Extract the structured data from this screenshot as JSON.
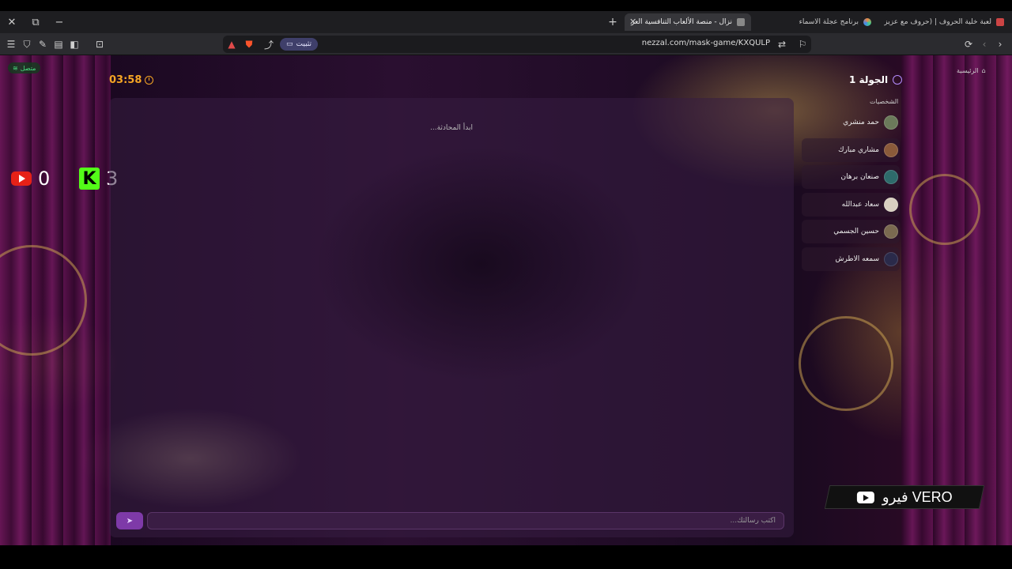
{
  "browser": {
    "tabs": [
      {
        "title": "نزال - منصة الألعاب التنافسية العر",
        "active": true
      },
      {
        "title": "برنامج عجلة الاسماء",
        "active": false
      },
      {
        "title": "لعبة خلية الحروف | (حروف مع عزيز) خلية",
        "active": false
      }
    ],
    "window_controls": {
      "close": "✕",
      "restore": "⧉",
      "minimize": "−"
    },
    "new_tab": "+",
    "url": "nezzal.com/mask-game/KXQULP",
    "install_label": "تثبيت"
  },
  "page": {
    "connection_status": "متصل",
    "timer": "03:58",
    "scores": {
      "youtube": "0",
      "kick": "3"
    },
    "kick_letter": "K",
    "home_label": "الرئيسية",
    "round_title": "الجولة 1",
    "characters_heading": "الشخصيات",
    "characters": [
      {
        "name": "حمد منشري",
        "avatar_color": "#6b7a5a"
      },
      {
        "name": "مشاري مبارك",
        "avatar_color": "#8a5a3a"
      },
      {
        "name": "صنعان برهان",
        "avatar_color": "#2e6b6b"
      },
      {
        "name": "سعاد عبدالله",
        "avatar_color": "#d8cfc0"
      },
      {
        "name": "حسين الجسمي",
        "avatar_color": "#7a6a50"
      },
      {
        "name": "سمعه الاطرش",
        "avatar_color": "#2a2a4a"
      }
    ],
    "chat_empty": "ابدأ المحادثة...",
    "message_placeholder": "اكتب رسالتك...",
    "streamer_badge": "فيرو VERO"
  }
}
